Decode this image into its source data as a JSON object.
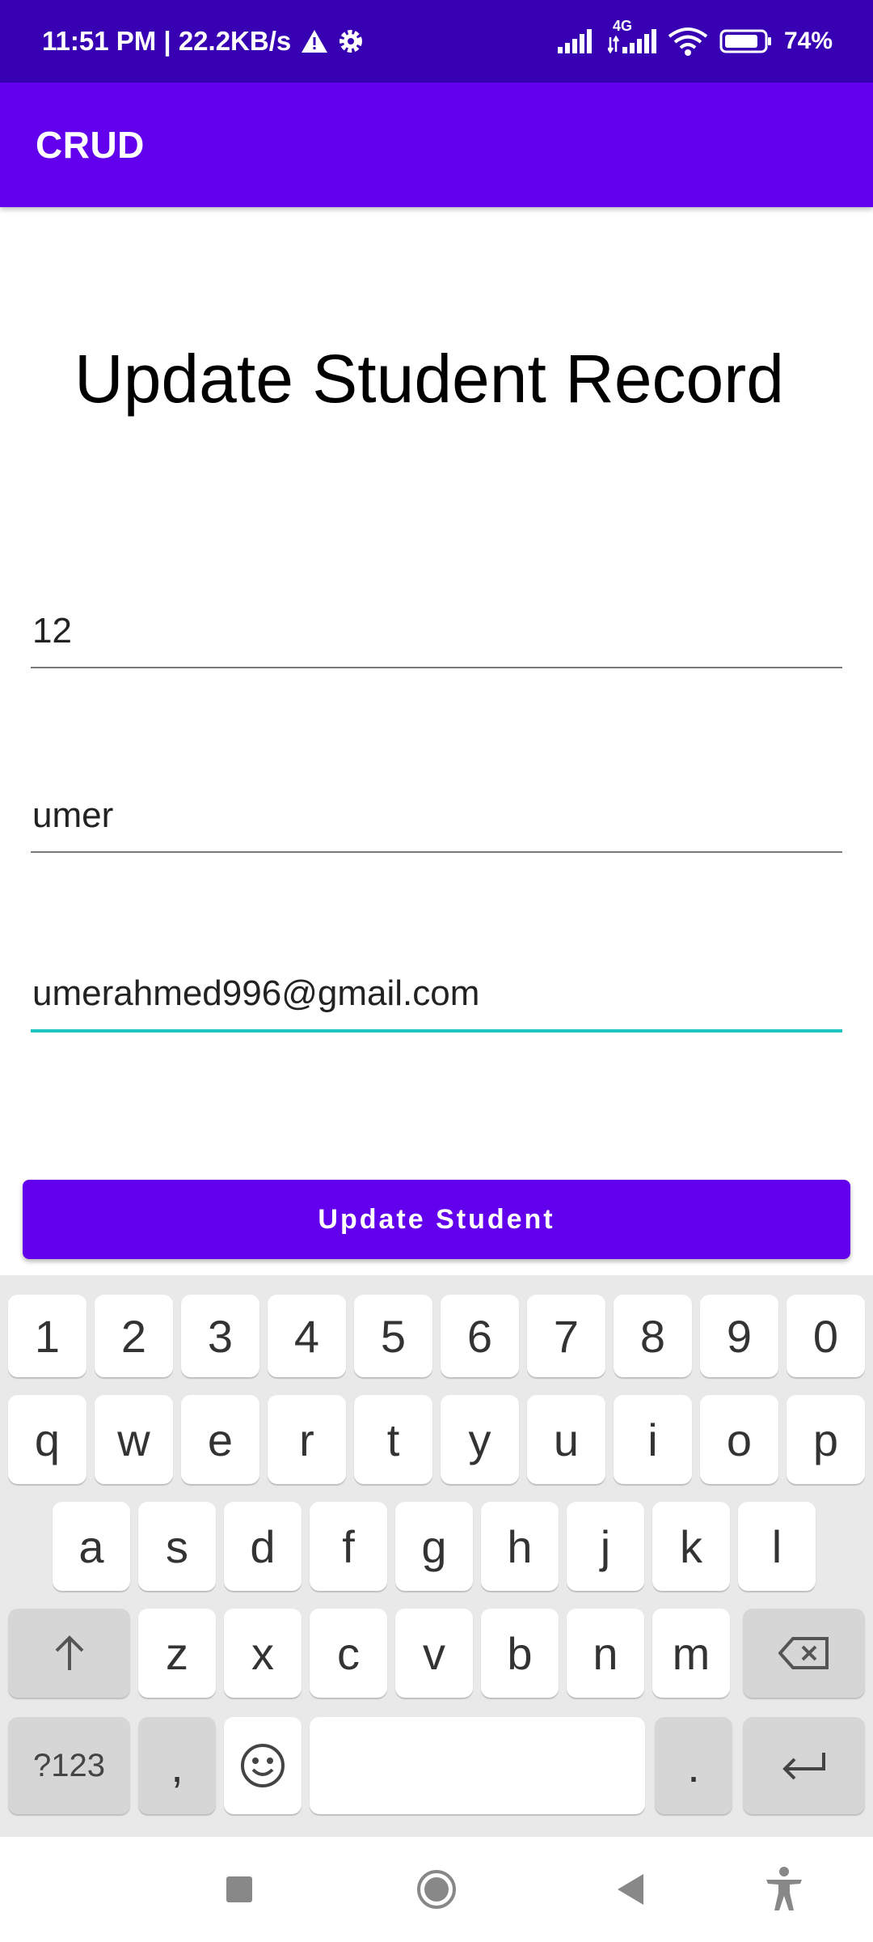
{
  "status_bar": {
    "time_and_speed": "11:51 PM | 22.2KB/s",
    "network_label": "4G",
    "battery": "74%",
    "icons": [
      "warning-icon",
      "gear-icon",
      "signal-icon",
      "signal-4g-icon",
      "wifi-icon",
      "battery-icon"
    ]
  },
  "app_bar": {
    "title": "CRUD"
  },
  "main": {
    "title": "Update Student Record",
    "fields": {
      "id": "12",
      "name": "umer",
      "email": "umerahmed996@gmail.com"
    },
    "update_button": "Update Student"
  },
  "keyboard": {
    "row1": [
      "1",
      "2",
      "3",
      "4",
      "5",
      "6",
      "7",
      "8",
      "9",
      "0"
    ],
    "row2": [
      "q",
      "w",
      "e",
      "r",
      "t",
      "y",
      "u",
      "i",
      "o",
      "p"
    ],
    "row3": [
      "a",
      "s",
      "d",
      "f",
      "g",
      "h",
      "j",
      "k",
      "l"
    ],
    "row4": [
      "z",
      "x",
      "c",
      "v",
      "b",
      "n",
      "m"
    ],
    "symbols": "?123",
    "comma": ",",
    "period": "."
  },
  "colors": {
    "status_bar": "#3700b3",
    "primary": "#6200ee",
    "focus_accent": "#1fc4c4"
  }
}
